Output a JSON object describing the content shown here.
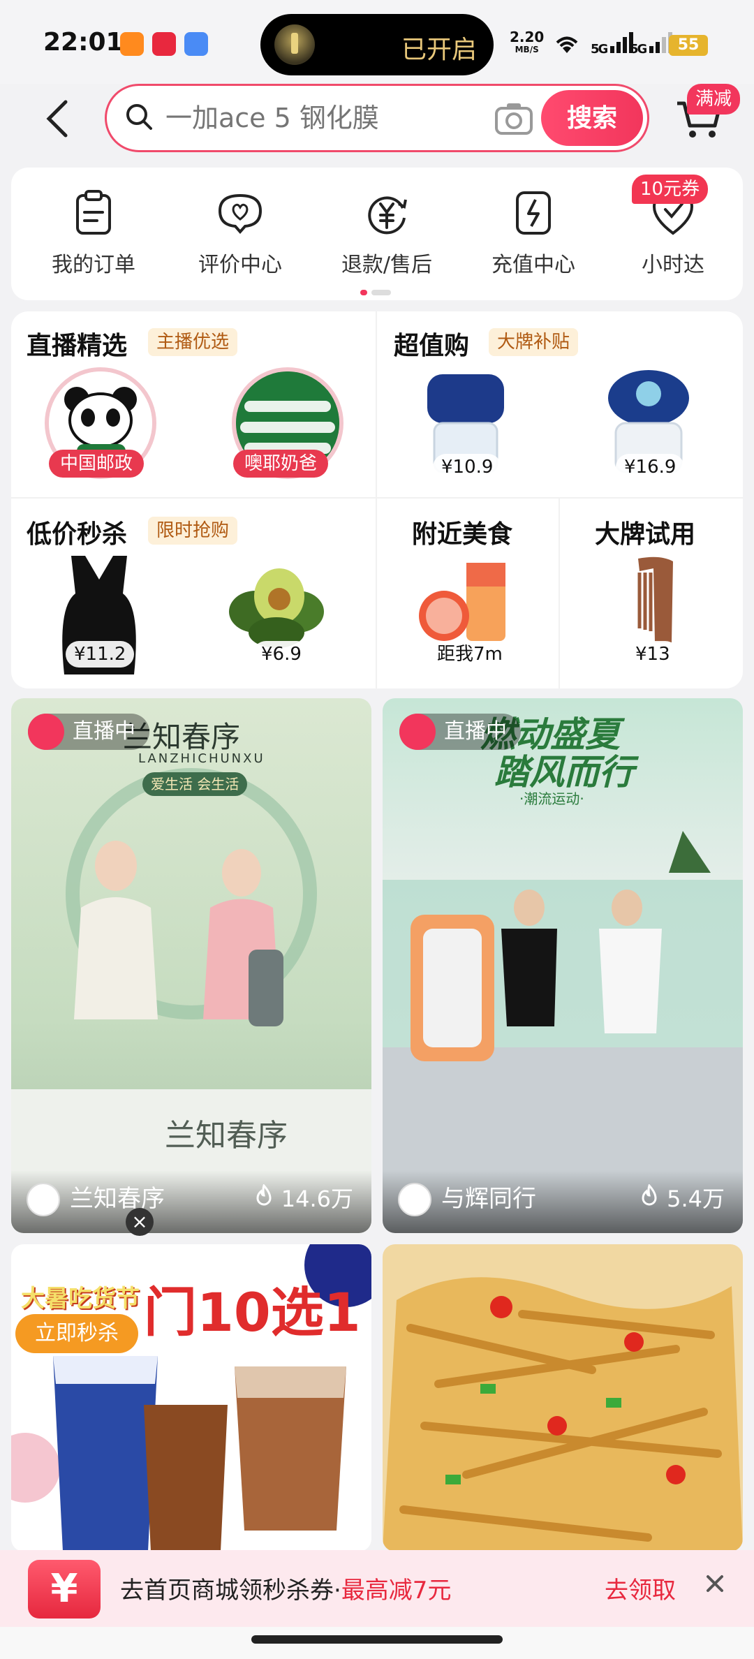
{
  "status_bar": {
    "time": "22:01",
    "pill_text": "已开启",
    "net_speed": "2.20",
    "net_unit": "MB/S",
    "sig1": "5G",
    "sig2": "5G",
    "battery": "55"
  },
  "header": {
    "search_placeholder": "一加ace 5 钢化膜",
    "search_button": "搜索",
    "cart_badge": "满减"
  },
  "quick_menu": {
    "items": [
      {
        "label": "我的订单",
        "icon": "order-icon"
      },
      {
        "label": "评价中心",
        "icon": "review-icon"
      },
      {
        "label": "退款/售后",
        "icon": "refund-icon"
      },
      {
        "label": "充值中心",
        "icon": "recharge-icon"
      },
      {
        "label": "小时达",
        "icon": "hour-delivery-icon"
      }
    ],
    "coupon_badge": "10元券"
  },
  "promo": {
    "live": {
      "title": "直播精选",
      "tag": "主播优选",
      "hosts": [
        "中国邮政",
        "噢耶奶爸"
      ]
    },
    "value": {
      "title": "超值购",
      "tag": "大牌补贴",
      "prices": [
        "¥10.9",
        "¥16.9"
      ]
    },
    "flash": {
      "title": "低价秒杀",
      "tag": "限时抢购",
      "prices": [
        "¥11.2",
        "¥6.9"
      ]
    },
    "food": {
      "title": "附近美食",
      "distance": "距我7m"
    },
    "trial": {
      "title": "大牌试用",
      "price": "¥13"
    }
  },
  "feed": {
    "live_label": "直播中",
    "cards": [
      {
        "host": "兰知春序",
        "heat": "14.6万",
        "brand": "兰知春序",
        "brand_en": "LANZHICHUNXU",
        "slogan": "爱生活 会生活"
      },
      {
        "host": "与辉同行",
        "heat": "5.4万",
        "headline1": "燃动盛夏",
        "headline2": "踏风而行",
        "sub": "·潮流运动·"
      }
    ],
    "coffee": {
      "ribbon": "大暑吃货节",
      "cta": "立即秒杀",
      "headline": "门10选1"
    }
  },
  "banner": {
    "text": "去首页商城领秒杀券·",
    "highlight": "最高减7元",
    "cta": "去领取"
  },
  "colors": {
    "accent": "#f2365c",
    "tag_bg": "#fdf0d9"
  }
}
